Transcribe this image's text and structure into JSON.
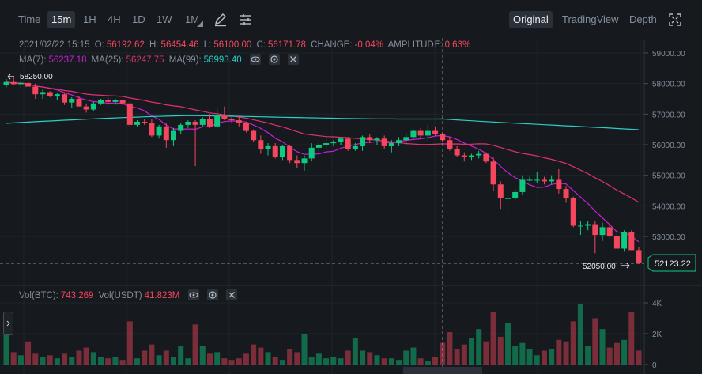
{
  "toolbar": {
    "intervals": [
      "Time",
      "15m",
      "1H",
      "4H",
      "1D",
      "1W",
      "1M"
    ],
    "active_interval": "15m",
    "views": [
      "Original",
      "TradingView",
      "Depth"
    ],
    "active_view": "Original"
  },
  "ohlc": {
    "date": "2021/02/22 15:15",
    "o_label": "O:",
    "o": "56192.62",
    "h_label": "H:",
    "h": "56454.46",
    "l_label": "L:",
    "l": "56100.00",
    "c_label": "C:",
    "c": "56171.78",
    "change_label": "CHANGE:",
    "change": "-0.04%",
    "amp_label": "AMPLITUDE:",
    "amp": "0.63%"
  },
  "ma": {
    "ma7_label": "MA(7):",
    "ma7": "56237.18",
    "ma25_label": "MA(25):",
    "ma25": "56247.75",
    "ma99_label": "MA(99):",
    "ma99": "56993.40"
  },
  "vol": {
    "btc_label": "Vol(BTC):",
    "btc": "743.269",
    "usdt_label": "Vol(USDT)",
    "usdt": "41.823M"
  },
  "price_axis": [
    "59000.00",
    "58000.00",
    "57000.00",
    "56000.00",
    "55000.00",
    "54000.00",
    "53000.00"
  ],
  "vol_axis": [
    "4K",
    "2K",
    "0"
  ],
  "markers": {
    "high": "58250.00",
    "low": "52050.00",
    "last_price": "52123.22"
  },
  "colors": {
    "up": "#0ecb81",
    "down": "#f6465d",
    "ma7": "#c71fd3",
    "ma25": "#e0306f",
    "ma99": "#27d0c9"
  },
  "chart_data": {
    "type": "candlestick",
    "interval": "15m",
    "ylim": [
      52000,
      59400
    ],
    "vol_ylim": [
      0,
      4800
    ],
    "candles": [
      [
        57950,
        58150,
        57880,
        58050,
        2100
      ],
      [
        58050,
        58200,
        57950,
        57980,
        800
      ],
      [
        57980,
        58100,
        57850,
        58020,
        600
      ],
      [
        58020,
        58250,
        57950,
        57900,
        1500
      ],
      [
        57900,
        58000,
        57500,
        57650,
        700
      ],
      [
        57650,
        57800,
        57500,
        57720,
        500
      ],
      [
        57720,
        57750,
        57550,
        57600,
        600
      ],
      [
        57600,
        57700,
        57450,
        57650,
        400
      ],
      [
        57650,
        57700,
        57300,
        57380,
        700
      ],
      [
        57380,
        57550,
        57200,
        57500,
        500
      ],
      [
        57500,
        57600,
        57350,
        57250,
        900
      ],
      [
        57250,
        57350,
        57050,
        57150,
        1100
      ],
      [
        57150,
        57400,
        57100,
        57350,
        800
      ],
      [
        57350,
        57500,
        57300,
        57450,
        500
      ],
      [
        57450,
        57550,
        57300,
        57400,
        400
      ],
      [
        57400,
        57500,
        57300,
        57450,
        500
      ],
      [
        57450,
        57480,
        57300,
        57350,
        300
      ],
      [
        57350,
        57400,
        56600,
        56650,
        2800
      ],
      [
        56650,
        56800,
        56600,
        56750,
        400
      ],
      [
        56750,
        56850,
        56650,
        56700,
        900
      ],
      [
        56700,
        56850,
        56250,
        56300,
        1300
      ],
      [
        56300,
        56650,
        56200,
        56600,
        600
      ],
      [
        56600,
        56700,
        55900,
        56150,
        900
      ],
      [
        56150,
        56550,
        55950,
        56450,
        500
      ],
      [
        56450,
        56700,
        56350,
        56650,
        1200
      ],
      [
        56650,
        56800,
        56550,
        56750,
        400
      ],
      [
        56750,
        56800,
        55300,
        56650,
        2600
      ],
      [
        56650,
        56900,
        56600,
        56850,
        1200
      ],
      [
        56850,
        57000,
        56550,
        56600,
        700
      ],
      [
        56600,
        57200,
        56550,
        56950,
        800
      ],
      [
        56950,
        57250,
        56800,
        56850,
        400
      ],
      [
        56850,
        56900,
        56700,
        56800,
        300
      ],
      [
        56800,
        56950,
        56600,
        56700,
        400
      ],
      [
        56700,
        56750,
        56400,
        56450,
        700
      ],
      [
        56450,
        56500,
        56100,
        56150,
        1300
      ],
      [
        56150,
        56300,
        55700,
        55850,
        1100
      ],
      [
        55850,
        56050,
        55650,
        55950,
        800
      ],
      [
        55950,
        56050,
        55550,
        55600,
        500
      ],
      [
        55600,
        56000,
        55500,
        55950,
        300
      ],
      [
        55950,
        56000,
        55400,
        55500,
        1000
      ],
      [
        55500,
        55650,
        55250,
        55400,
        800
      ],
      [
        55400,
        55650,
        55150,
        55550,
        2000
      ],
      [
        55550,
        56050,
        55450,
        55900,
        500
      ],
      [
        55900,
        56100,
        55750,
        56000,
        700
      ],
      [
        56000,
        56250,
        55850,
        56050,
        400
      ],
      [
        56050,
        56150,
        55950,
        56100,
        500
      ],
      [
        56100,
        56250,
        56000,
        56200,
        400
      ],
      [
        56200,
        56250,
        55800,
        55850,
        900
      ],
      [
        55850,
        56050,
        55800,
        55950,
        1700
      ],
      [
        55950,
        56300,
        55800,
        56250,
        900
      ],
      [
        56250,
        56350,
        56050,
        56150,
        800
      ],
      [
        56150,
        56250,
        56000,
        56200,
        600
      ],
      [
        56200,
        56300,
        55850,
        55950,
        400
      ],
      [
        55950,
        56150,
        55750,
        56050,
        400
      ],
      [
        56050,
        56250,
        55950,
        56150,
        300
      ],
      [
        56150,
        56350,
        56000,
        56250,
        900
      ],
      [
        56250,
        56500,
        56200,
        56450,
        1100
      ],
      [
        56450,
        56550,
        56200,
        56300,
        400
      ],
      [
        56300,
        56650,
        56150,
        56450,
        200
      ],
      [
        56450,
        56600,
        56300,
        56350,
        500
      ],
      [
        56350,
        56400,
        56100,
        56150,
        1400
      ],
      [
        56150,
        56250,
        55800,
        55850,
        2100
      ],
      [
        55850,
        55950,
        55600,
        55650,
        1000
      ],
      [
        55650,
        55750,
        55450,
        55600,
        1300
      ],
      [
        55600,
        55700,
        55500,
        55650,
        1700
      ],
      [
        55650,
        55800,
        55550,
        55700,
        2300
      ],
      [
        55700,
        55750,
        55400,
        55450,
        1500
      ],
      [
        55450,
        55600,
        54500,
        54700,
        3400
      ],
      [
        54700,
        54800,
        53900,
        54250,
        1800
      ],
      [
        54250,
        54500,
        53450,
        54250,
        2700
      ],
      [
        54250,
        54550,
        54200,
        54450,
        1200
      ],
      [
        54450,
        55000,
        54350,
        54850,
        1400
      ],
      [
        54850,
        54950,
        54800,
        54850,
        1000
      ],
      [
        54850,
        55100,
        54750,
        54850,
        600
      ],
      [
        54850,
        54950,
        54700,
        54800,
        900
      ],
      [
        54800,
        55000,
        54700,
        54850,
        1000
      ],
      [
        54850,
        55200,
        54400,
        54550,
        1600
      ],
      [
        54550,
        54650,
        54100,
        54250,
        1500
      ],
      [
        54250,
        54300,
        53300,
        53350,
        2800
      ],
      [
        53350,
        53500,
        53050,
        53350,
        3900
      ],
      [
        53350,
        53500,
        53200,
        53400,
        1200
      ],
      [
        53400,
        53500,
        52450,
        53050,
        3000
      ],
      [
        53050,
        53450,
        52850,
        53300,
        2300
      ],
      [
        53300,
        53400,
        52950,
        53000,
        1100
      ],
      [
        53000,
        53200,
        52750,
        52600,
        1400
      ],
      [
        52600,
        53200,
        52500,
        53150,
        1600
      ],
      [
        53150,
        53200,
        52800,
        52550,
        3400
      ],
      [
        52550,
        52650,
        52100,
        52123,
        900
      ]
    ]
  }
}
